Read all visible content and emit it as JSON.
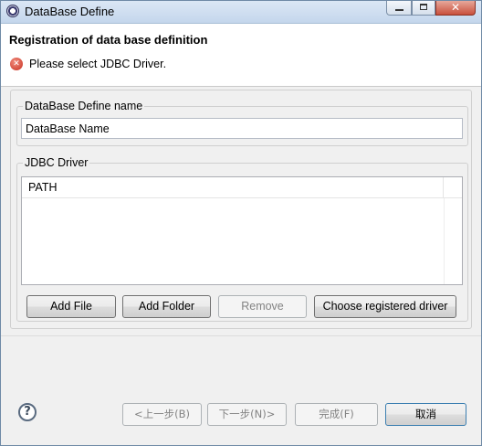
{
  "window": {
    "title": "DataBase Define",
    "controls": {
      "minimize_icon": "minimize-icon",
      "maximize_icon": "maximize-icon",
      "close_glyph": "✕"
    }
  },
  "header": {
    "title": "Registration of data base definition",
    "error_icon": "error-icon",
    "error_glyph": "✕",
    "message": "Please select JDBC Driver."
  },
  "name_group": {
    "label": "DataBase Define name",
    "input_value": "DataBase Name"
  },
  "driver_group": {
    "label": "JDBC Driver",
    "table": {
      "columns": [
        "PATH"
      ],
      "rows": []
    },
    "buttons": {
      "add_file": "Add File",
      "add_folder": "Add Folder",
      "remove": "Remove",
      "choose_registered": "Choose registered driver"
    }
  },
  "footer": {
    "help_icon": "help-icon",
    "help_glyph": "?",
    "back": "<上一步(B)",
    "next": "下一步(N)>",
    "finish": "完成(F)",
    "cancel": "取消"
  },
  "colors": {
    "error": "#c72f20",
    "default_button_border": "#3c7fb1"
  }
}
